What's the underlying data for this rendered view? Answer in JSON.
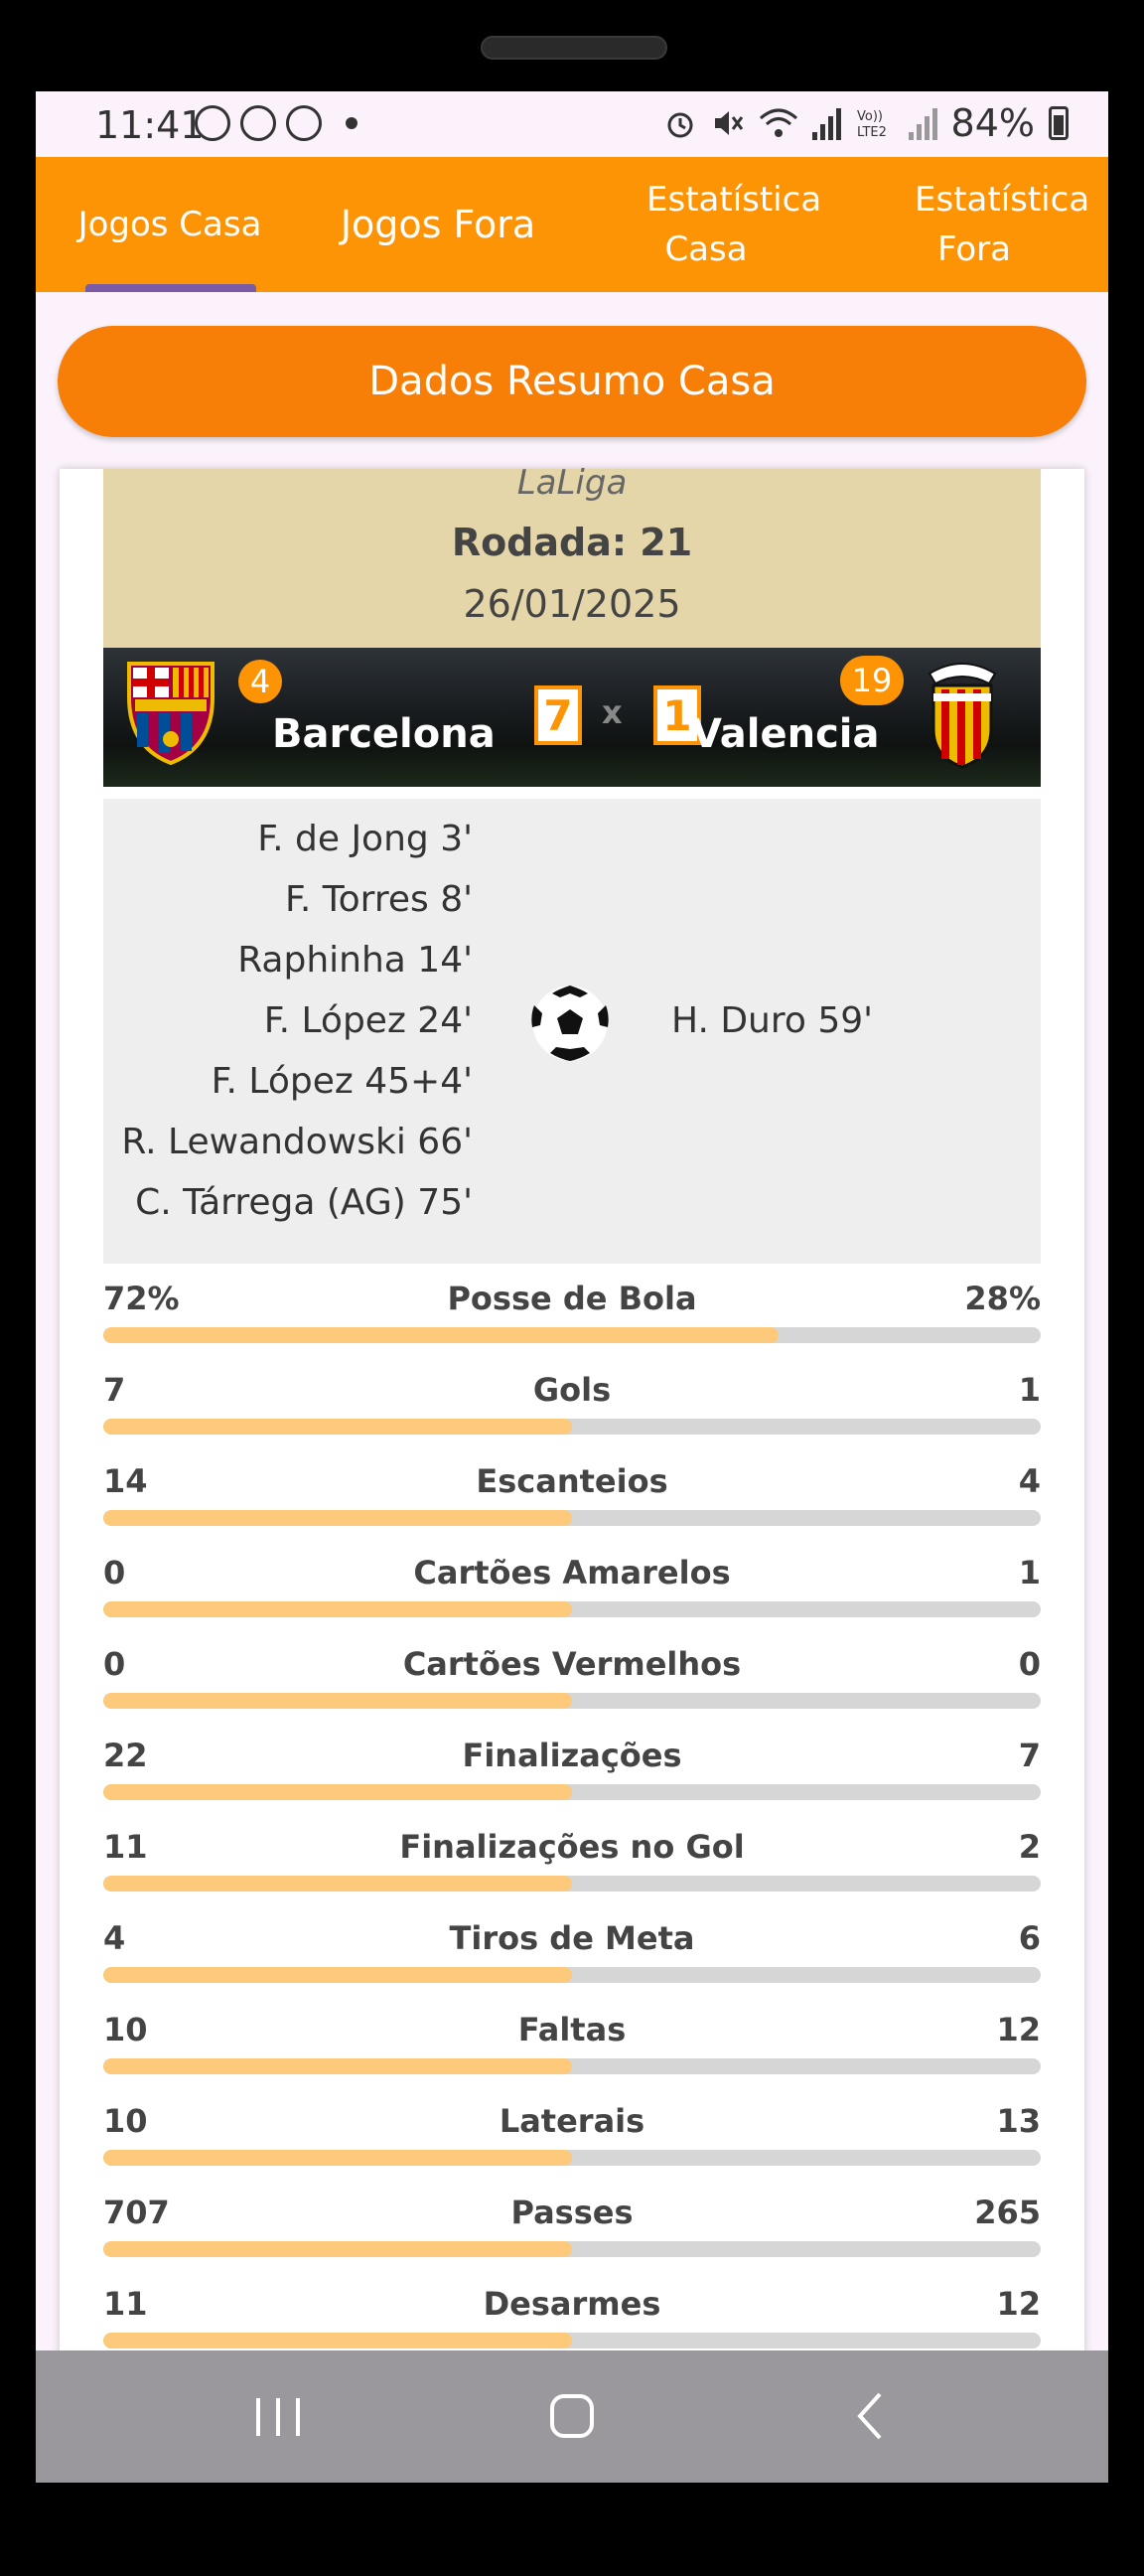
{
  "status_bar": {
    "time": "11:41",
    "battery": "84%"
  },
  "tabs": [
    {
      "label": "Jogos Casa"
    },
    {
      "label": "Jogos Fora"
    },
    {
      "label": "Estatística Casa"
    },
    {
      "label": "Estatística Fora"
    }
  ],
  "main_button": "Dados Resumo Casa",
  "match": {
    "league": "LaLiga",
    "round": "Rodada: 21",
    "date": "26/01/2025",
    "home_team": "Barcelona",
    "away_team": "Valencia",
    "home_position": "4",
    "away_position": "19",
    "home_score": "7",
    "score_separator": "x",
    "away_score": "1",
    "home_scorers": [
      "F. de Jong 3'",
      "F. Torres 8'",
      "Raphinha 14'",
      "F. López 24'",
      "F. López 45+4'",
      "R. Lewandowski 66'",
      "C. Tárrega (AG) 75'"
    ],
    "away_scorers": [
      "H. Duro 59'"
    ]
  },
  "stats": [
    {
      "label": "Posse de Bola",
      "home": "72%",
      "away": "28%",
      "fill": 0.72
    },
    {
      "label": "Gols",
      "home": "7",
      "away": "1",
      "fill": 0.5
    },
    {
      "label": "Escanteios",
      "home": "14",
      "away": "4",
      "fill": 0.5
    },
    {
      "label": "Cartões Amarelos",
      "home": "0",
      "away": "1",
      "fill": 0.5
    },
    {
      "label": "Cartões Vermelhos",
      "home": "0",
      "away": "0",
      "fill": 0.5
    },
    {
      "label": "Finalizações",
      "home": "22",
      "away": "7",
      "fill": 0.5
    },
    {
      "label": "Finalizações no Gol",
      "home": "11",
      "away": "2",
      "fill": 0.5
    },
    {
      "label": "Tiros de Meta",
      "home": "4",
      "away": "6",
      "fill": 0.5
    },
    {
      "label": "Faltas",
      "home": "10",
      "away": "12",
      "fill": 0.5
    },
    {
      "label": "Laterais",
      "home": "10",
      "away": "13",
      "fill": 0.5
    },
    {
      "label": "Passes",
      "home": "707",
      "away": "265",
      "fill": 0.5
    },
    {
      "label": "Desarmes",
      "home": "11",
      "away": "12",
      "fill": 0.5
    }
  ],
  "colors": {
    "accent": "#fd9406",
    "button": "#f77e07",
    "header_bg": "#e4d6a8",
    "stat_fill": "#fdc97a",
    "stat_track": "#d6d6d6"
  },
  "icons": [
    "whatsapp-icon",
    "chrome-icon",
    "alarm-icon",
    "mute-icon",
    "wifi-icon",
    "signal-icon",
    "battery-icon",
    "barcelona-crest-icon",
    "valencia-crest-icon",
    "soccer-ball-icon",
    "recents-icon",
    "home-icon",
    "back-icon"
  ]
}
